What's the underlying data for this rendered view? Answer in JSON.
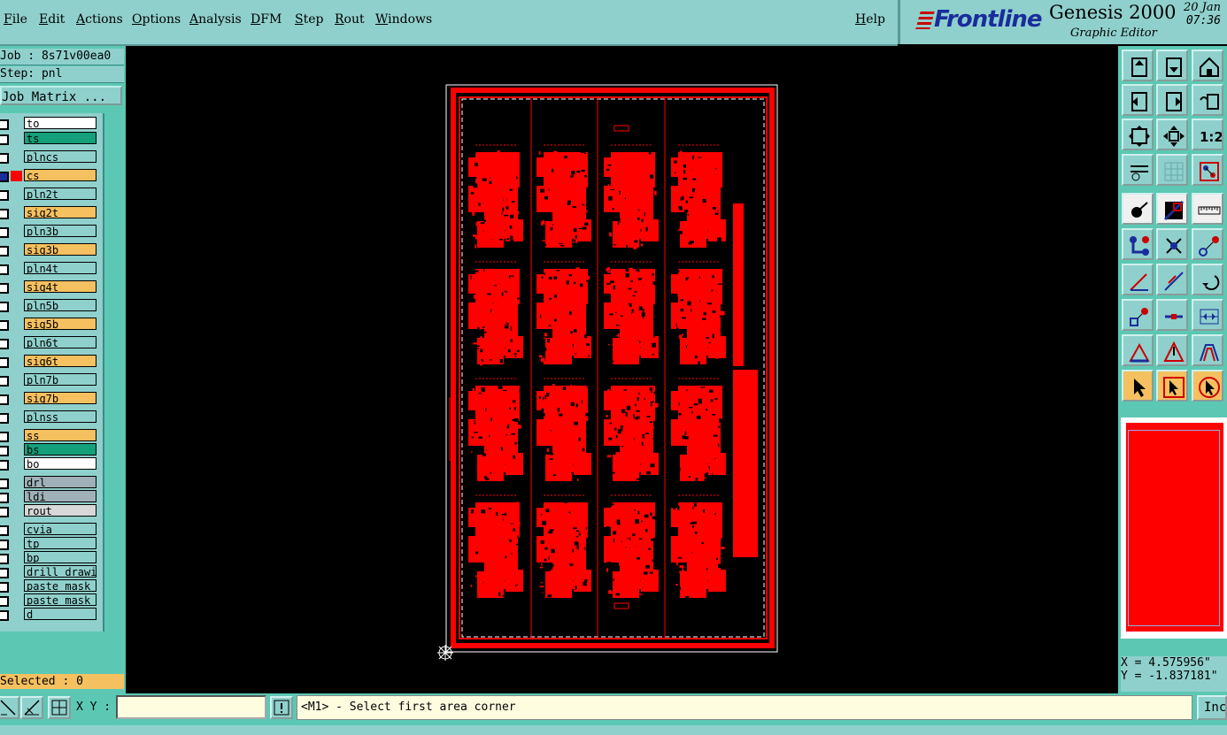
{
  "menu": {
    "items": [
      "File",
      "Edit",
      "Actions",
      "Options",
      "Analysis",
      "DFM",
      "Step",
      "Rout",
      "Windows"
    ],
    "help": "Help"
  },
  "brand": {
    "logo": "Frontline",
    "title": "Genesis 2000",
    "subtitle": "Graphic Editor",
    "date": "20 Jan",
    "time": "07:36"
  },
  "job": {
    "job_line": "Job : 8s71v00ea0",
    "step_line": "Step: pnl",
    "matrix_button": "Job Matrix ..."
  },
  "layers": [
    {
      "name": "to",
      "color": "#ffffff"
    },
    {
      "name": "ts",
      "color": "#14a07a"
    },
    {
      "name": "plncs",
      "color": "#8fd0cc"
    },
    {
      "name": "cs",
      "color": "#f5c060",
      "active": true
    },
    {
      "name": "pln2t",
      "color": "#8fd0cc"
    },
    {
      "name": "sig2t",
      "color": "#f5c060"
    },
    {
      "name": "pln3b",
      "color": "#8fd0cc"
    },
    {
      "name": "sig3b",
      "color": "#f5c060"
    },
    {
      "name": "pln4t",
      "color": "#8fd0cc"
    },
    {
      "name": "sig4t",
      "color": "#f5c060"
    },
    {
      "name": "pln5b",
      "color": "#8fd0cc"
    },
    {
      "name": "sig5b",
      "color": "#f5c060"
    },
    {
      "name": "pln6t",
      "color": "#8fd0cc"
    },
    {
      "name": "sig6t",
      "color": "#f5c060"
    },
    {
      "name": "pln7b",
      "color": "#8fd0cc"
    },
    {
      "name": "sig7b",
      "color": "#f5c060"
    },
    {
      "name": "plnss",
      "color": "#8fd0cc"
    },
    {
      "name": "ss",
      "color": "#f5c060"
    },
    {
      "name": "bs",
      "color": "#14a07a"
    },
    {
      "name": "bo",
      "color": "#ffffff"
    },
    {
      "name": "drl",
      "color": "#a0b0b8"
    },
    {
      "name": "ldi",
      "color": "#a0b0b8"
    },
    {
      "name": "rout",
      "color": "#d8d8d8"
    },
    {
      "name": "cvia",
      "color": "#8fd0cc"
    },
    {
      "name": "tp",
      "color": "#8fd0cc"
    },
    {
      "name": "bp",
      "color": "#8fd0cc"
    },
    {
      "name": "drill_drawing",
      "color": "#8fd0cc"
    },
    {
      "name": "paste_mask_b",
      "color": "#8fd0cc"
    },
    {
      "name": "paste_mask_t",
      "color": "#8fd0cc"
    },
    {
      "name": "d",
      "color": "#8fd0cc"
    }
  ],
  "selected_text": "Selected : 0",
  "coords": {
    "x": "X = 4.575956\"",
    "y": "Y = -1.837181\""
  },
  "bottom": {
    "xy_label": "X Y :",
    "xy_value": "",
    "message": "<M1> - Select first area corner",
    "inc_button": "Inc"
  },
  "toolbar_icons": [
    "zoom-home-icon",
    "zoom-back-icon",
    "house-icon",
    "pan-left-icon",
    "pan-right-icon",
    "undo-zoom-icon",
    "fit-all-icon",
    "fit-profile-icon",
    "one-to-two-icon",
    "settings-icon",
    "grid-icon",
    "layers-icon",
    "snap-icon",
    "measure-area-icon",
    "ruler-icon",
    "connect-icon",
    "cross-icon",
    "point-icon",
    "line-icon",
    "diagonal-icon",
    "arc-icon",
    "pad-icon",
    "pin-icon",
    "dimension-icon",
    "triangle-icon",
    "triangle-select-icon",
    "triangle-fill-icon",
    "select-icon",
    "select-frame-icon",
    "select-rotate-icon"
  ],
  "colors": {
    "accent": "#8fd0cc",
    "panel": "#5cc8b4",
    "highlight": "#f5c060",
    "copper": "#ff0000"
  }
}
